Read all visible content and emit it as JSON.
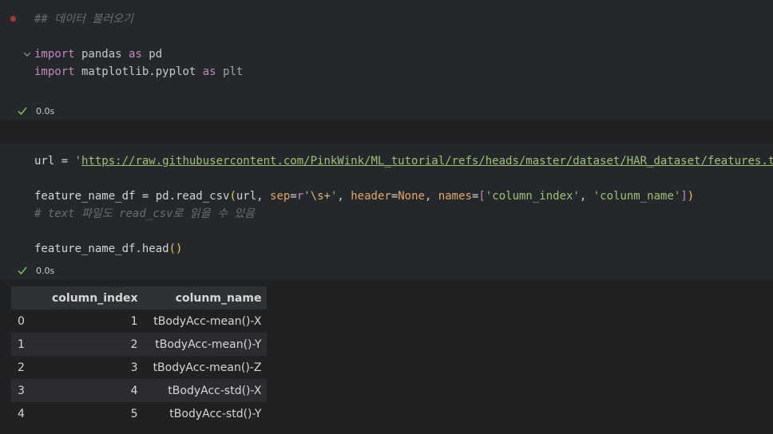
{
  "cells": [
    {
      "lines": {
        "comment": "## 데이터 불러오기",
        "imp1_kw": "import",
        "imp1_mod": " pandas ",
        "imp1_as": "as",
        "imp1_alias": " pd",
        "imp2_kw": "import",
        "imp2_mod": " matplotlib.pyplot ",
        "imp2_as": "as",
        "imp2_alias": " plt"
      },
      "exec_time": "0.0s"
    },
    {
      "lines": {
        "url_var": "url = ",
        "url_q1": "'",
        "url_value": "https://raw.githubusercontent.com/PinkWink/ML_tutorial/refs/heads/master/dataset/HAR_dataset/features.txt",
        "url_q2": "'",
        "df_assign": "feature_name_df = pd.read_csv",
        "paren_open": "(",
        "arg_url": "url, ",
        "p_sep": "sep",
        "eq1": "=",
        "r_prefix": "r",
        "sep_q1": "'",
        "sep_esc": "\\s+",
        "sep_q2": "'",
        "comma1": ", ",
        "p_header": "header",
        "eq2": "=",
        "none_val": "None",
        "comma2": ", ",
        "p_names": "names",
        "eq3": "=",
        "list_open": "[",
        "name1": "'column_index'",
        "comma3": ", ",
        "name2": "'colunm_name'",
        "list_close": "]",
        "paren_close": ")",
        "comment": "# text 파일도 read_csv로 읽을 수 있음",
        "head_call": "feature_name_df.head",
        "head_parens": "()"
      },
      "exec_time": "0.0s"
    }
  ],
  "table": {
    "headers": [
      "",
      "column_index",
      "colunm_name"
    ],
    "rows": [
      [
        "0",
        "1",
        "tBodyAcc-mean()-X"
      ],
      [
        "1",
        "2",
        "tBodyAcc-mean()-Y"
      ],
      [
        "2",
        "3",
        "tBodyAcc-mean()-Z"
      ],
      [
        "3",
        "4",
        "tBodyAcc-std()-X"
      ],
      [
        "4",
        "5",
        "tBodyAcc-std()-Y"
      ]
    ]
  },
  "icons": {
    "run_marker": "breakpoint-dot-icon",
    "fold": "chevron-down-icon",
    "status": "check-icon"
  },
  "colors": {
    "success": "#6cc04a",
    "breakpoint": "#b3303b"
  }
}
